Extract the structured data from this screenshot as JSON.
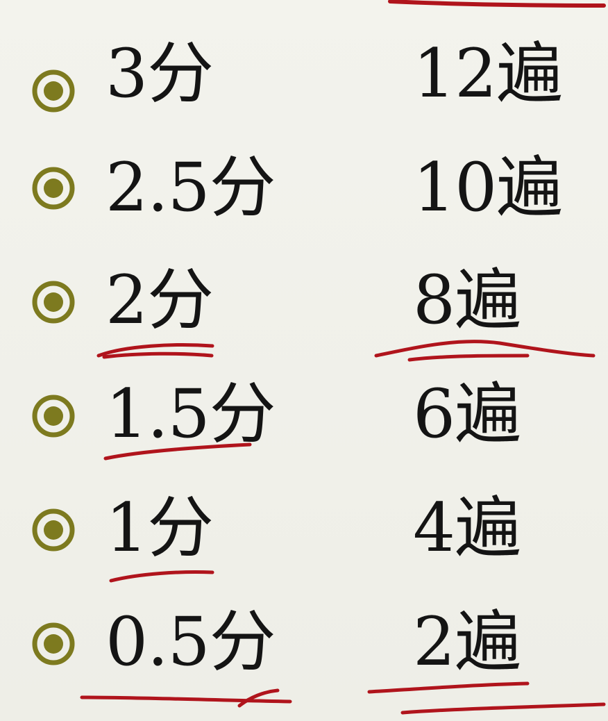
{
  "bullet_color": "#7d7a1f",
  "ink_color": "#b0141c",
  "bullet_icon": "radio-bullet-icon",
  "rows": [
    {
      "duration": "3分",
      "times": "12遍"
    },
    {
      "duration": "2.5分",
      "times": "10遍"
    },
    {
      "duration": "2分",
      "times": "8遍"
    },
    {
      "duration": "1.5分",
      "times": "6遍"
    },
    {
      "duration": "1分",
      "times": "4遍"
    },
    {
      "duration": "0.5分",
      "times": "2遍"
    }
  ]
}
